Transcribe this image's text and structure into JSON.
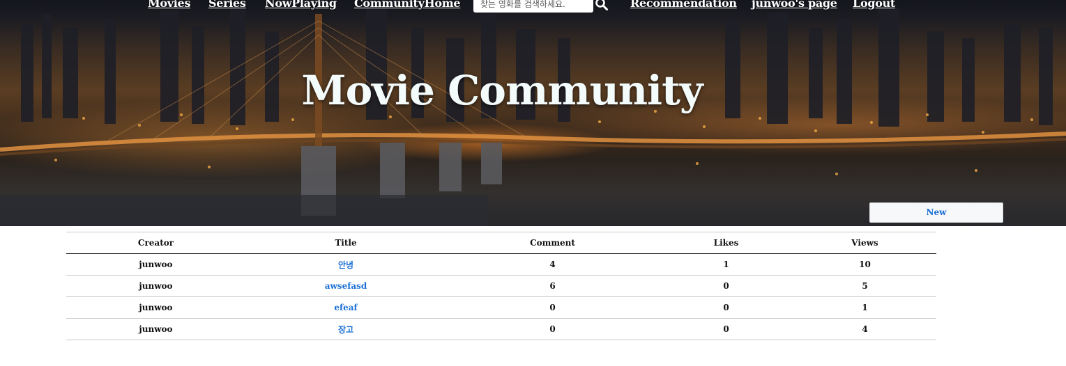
{
  "nav": {
    "movies": "Movies",
    "series": "Series",
    "now_playing": "NowPlaying",
    "community_home": "CommunityHome",
    "search_placeholder": "찾는 영화를 검색하세요.",
    "recommendation": "Recommendation",
    "user_page": "junwoo's page",
    "logout": "Logout"
  },
  "hero": {
    "title": "Movie Community"
  },
  "new_button": "New",
  "table": {
    "headers": [
      "Creator",
      "Title",
      "Comment",
      "Likes",
      "Views"
    ],
    "rows": [
      {
        "creator": "junwoo",
        "title": "안녕",
        "comment": "4",
        "likes": "1",
        "views": "10"
      },
      {
        "creator": "junwoo",
        "title": "awsefasd",
        "comment": "6",
        "likes": "0",
        "views": "5"
      },
      {
        "creator": "junwoo",
        "title": "efeaf",
        "comment": "0",
        "likes": "0",
        "views": "1"
      },
      {
        "creator": "junwoo",
        "title": "장고",
        "comment": "0",
        "likes": "0",
        "views": "4"
      }
    ]
  },
  "colors": {
    "link": "#1a6fd4",
    "hero_text": "#f4fbfb"
  },
  "icons": {
    "search": "search-icon"
  }
}
